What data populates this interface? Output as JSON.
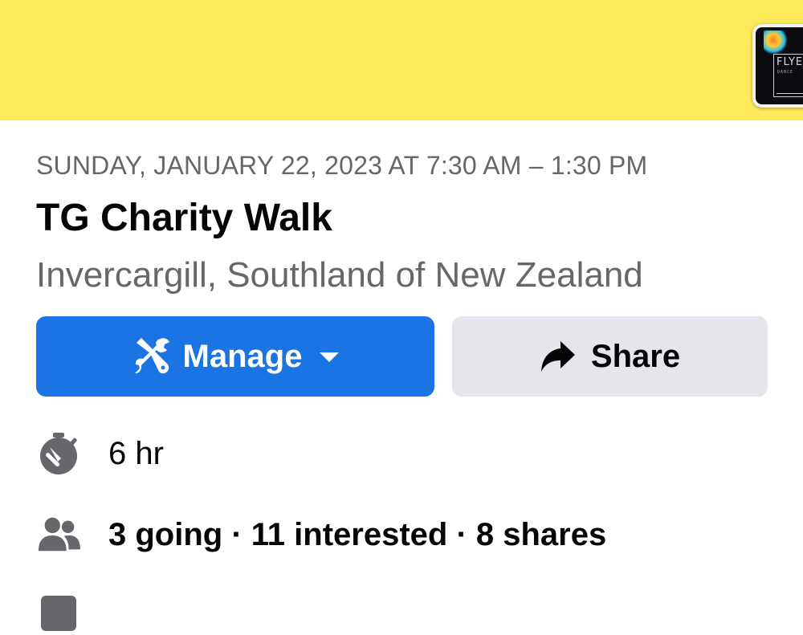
{
  "cover": {
    "color": "#fdea5a",
    "host_logo": {
      "text": "FLYE",
      "subtext": "DANCE"
    }
  },
  "event": {
    "date_time": "SUNDAY, JANUARY 22, 2023 AT 7:30 AM – 1:30 PM",
    "title": "TG Charity Walk",
    "location": "Invercargill, Southland of New Zealand"
  },
  "actions": {
    "manage": {
      "label": "Manage",
      "icon": "tools-icon",
      "color": "#1b74e4"
    },
    "share": {
      "label": "Share",
      "icon": "share-arrow-icon",
      "color": "#e4e6eb"
    }
  },
  "details": {
    "duration": {
      "icon": "stopwatch-icon",
      "text": "6 hr"
    },
    "stats": {
      "icon": "people-icon",
      "text": "3 going · 11 interested · 8 shares"
    },
    "partial_row": {
      "icon": "calendar-icon",
      "text": ""
    }
  }
}
